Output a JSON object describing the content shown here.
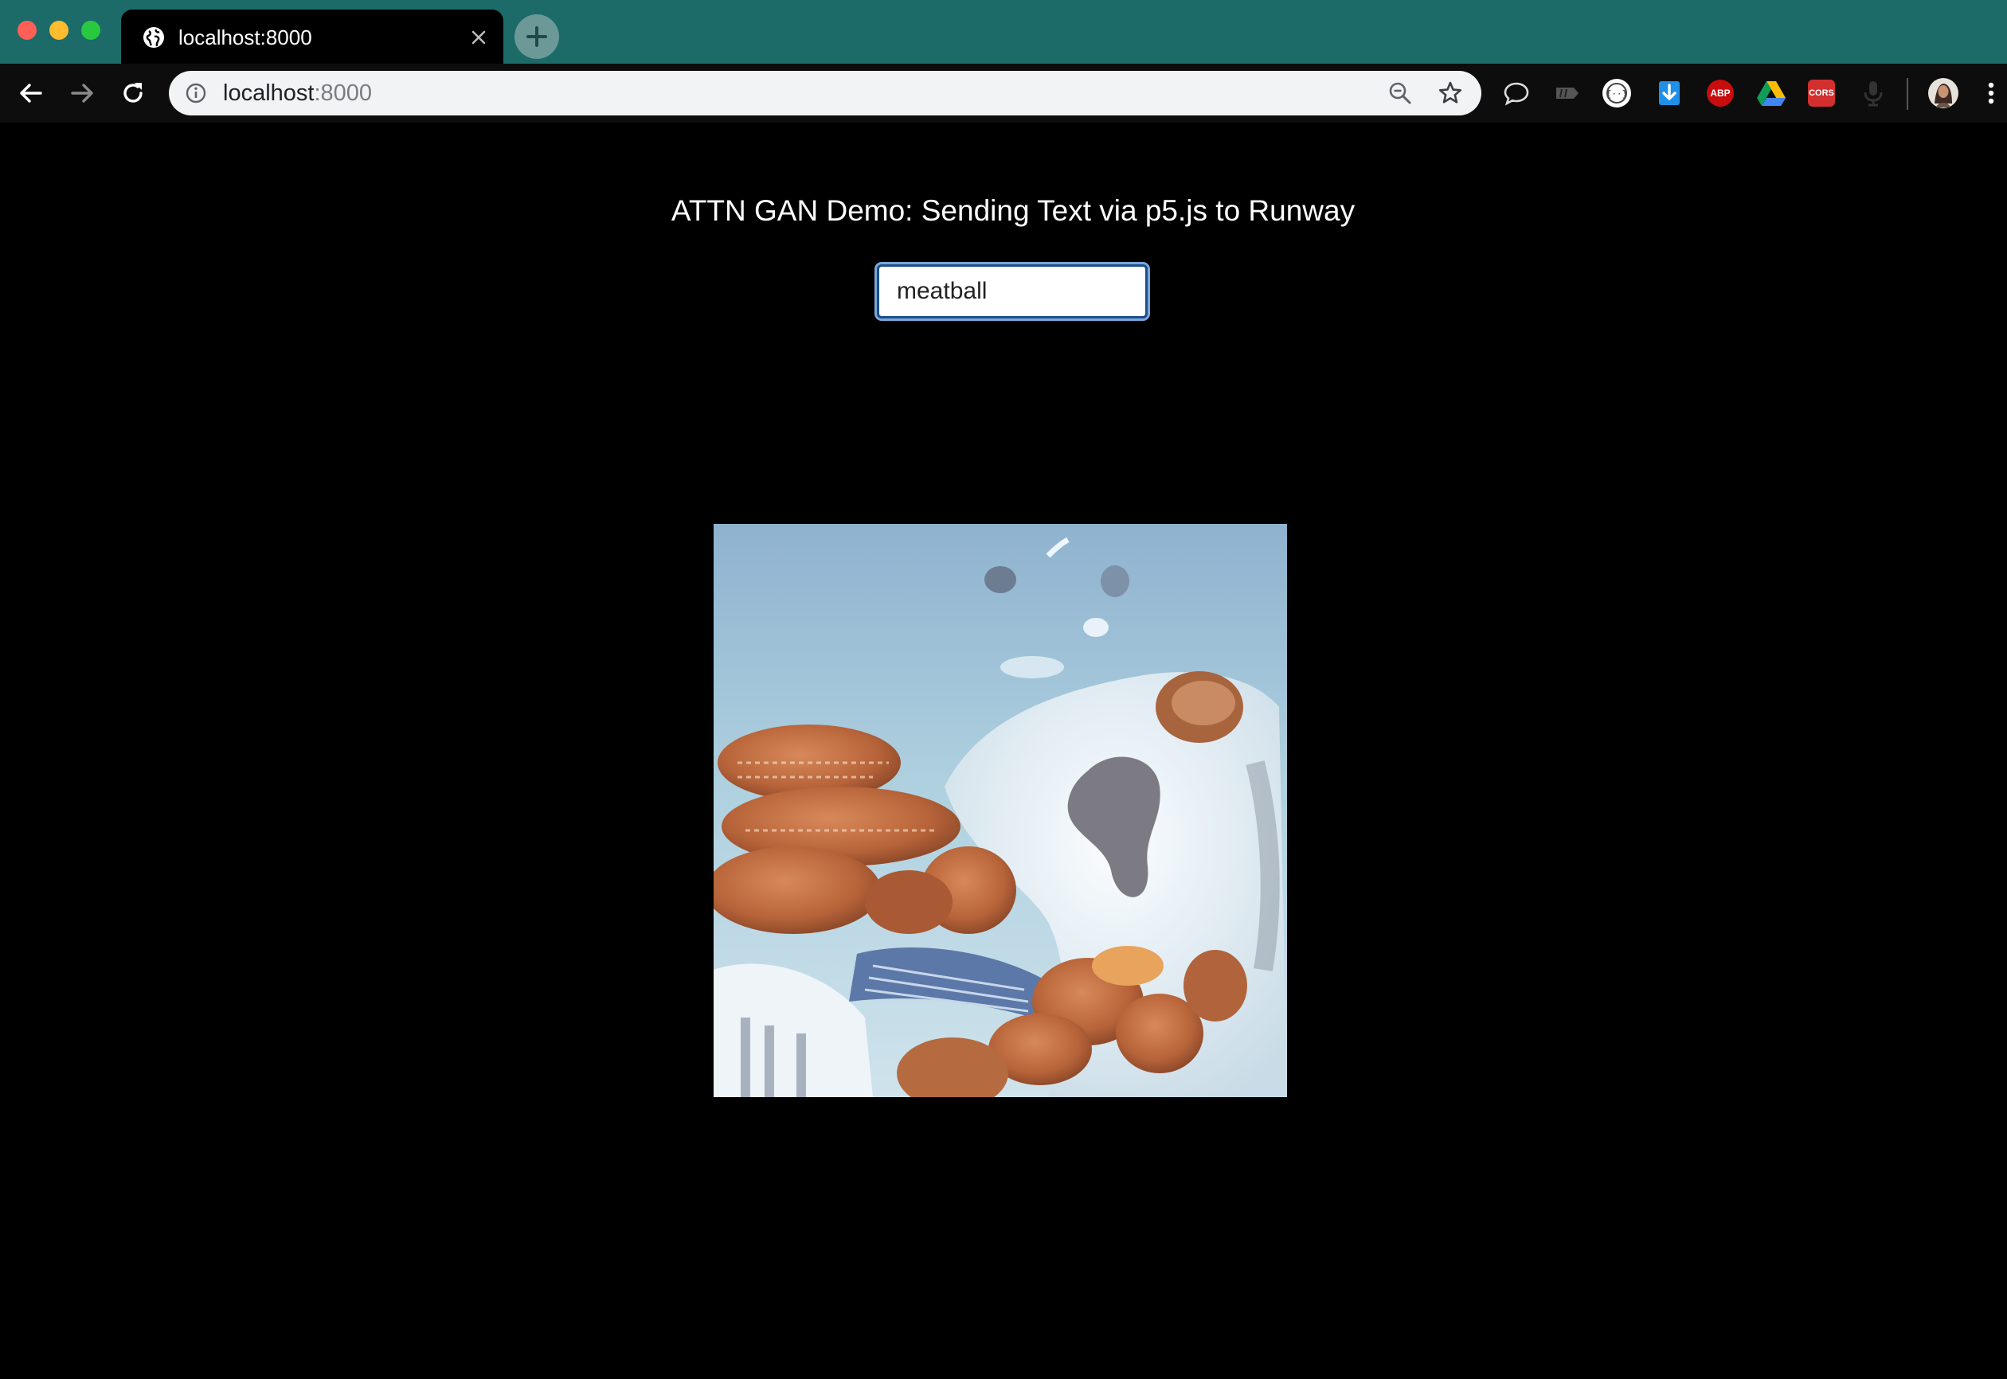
{
  "browser": {
    "tab": {
      "title": "localhost:8000",
      "favicon": "globe-icon"
    },
    "new_tab_icon": "plus-icon",
    "toolbar": {
      "back_icon": "arrow-left-icon",
      "forward_icon": "arrow-right-icon",
      "reload_icon": "reload-icon"
    },
    "address_bar": {
      "host": "localhost",
      "port": ":8000",
      "info_icon": "info-icon",
      "zoom_icon": "zoom-out-icon",
      "bookmark_icon": "star-icon"
    },
    "extensions": [
      {
        "name": "chat-bubble-icon"
      },
      {
        "name": "tag-extension-icon"
      },
      {
        "name": "json-viewer-icon"
      },
      {
        "name": "download-icon"
      },
      {
        "name": "adblock-plus-icon",
        "label": "ABP",
        "color": "#c70d0d"
      },
      {
        "name": "google-drive-icon"
      },
      {
        "name": "cors-extension-icon",
        "label": "CORS",
        "color": "#d32f2f"
      },
      {
        "name": "microphone-icon"
      }
    ],
    "profile_icon": "avatar-icon",
    "menu_icon": "kebab-menu-icon"
  },
  "page": {
    "title": "ATTN GAN Demo: Sending Text via p5.js to Runway",
    "input_value": "meatball",
    "generated_image": "gan-generated-image"
  },
  "colors": {
    "tabstrip": "#1c6b68",
    "page_background": "#000000",
    "input_border": "#1b4f8a"
  }
}
